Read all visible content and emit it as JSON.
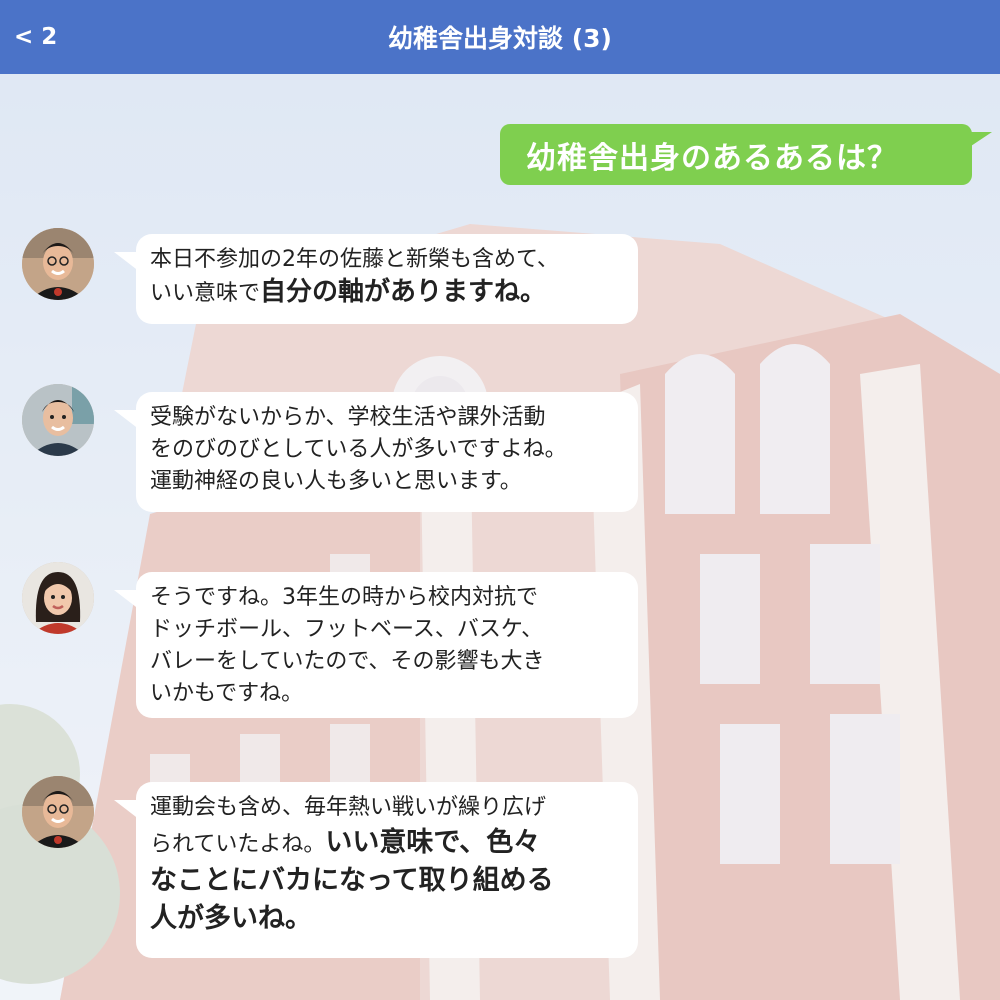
{
  "header": {
    "back_label": "< 2",
    "title": "幼稚舎出身対談 (3)"
  },
  "colors": {
    "header_bg": "#4b73c8",
    "outgoing_bubble": "#7fcf4f",
    "incoming_bubble": "#ffffff"
  },
  "messages": [
    {
      "direction": "outgoing",
      "lines": [
        "幼稚舎出身のあるあるは？"
      ]
    },
    {
      "direction": "incoming",
      "avatar": "avatar-man-glasses-icon",
      "lines": [
        {
          "normal": "本日不参加の2年の佐藤と新榮も含めて、"
        },
        {
          "normal": "いい意味で",
          "bold": "自分の軸がありますね。"
        }
      ]
    },
    {
      "direction": "incoming",
      "avatar": "avatar-man-icon",
      "lines": [
        {
          "normal": "受験がないからか、学校生活や課外活動"
        },
        {
          "normal": "をのびのびとしている人が多いですよね。"
        },
        {
          "normal": "運動神経の良い人も多いと思います。"
        }
      ]
    },
    {
      "direction": "incoming",
      "avatar": "avatar-woman-icon",
      "lines": [
        {
          "normal": "そうですね。3年生の時から校内対抗で"
        },
        {
          "normal": "ドッチボール、フットベース、バスケ、"
        },
        {
          "normal": "バレーをしていたので、その影響も大き"
        },
        {
          "normal": "いかもですね。"
        }
      ]
    },
    {
      "direction": "incoming",
      "avatar": "avatar-man-glasses-icon",
      "lines": [
        {
          "normal": "運動会も含め、毎年熱い戦いが繰り広げ"
        },
        {
          "normal": "られていたよね。",
          "bold": "いい意味で、色々"
        },
        {
          "bold": "なことにバカになって取り組める"
        },
        {
          "bold": "人が多いね。"
        }
      ]
    }
  ]
}
